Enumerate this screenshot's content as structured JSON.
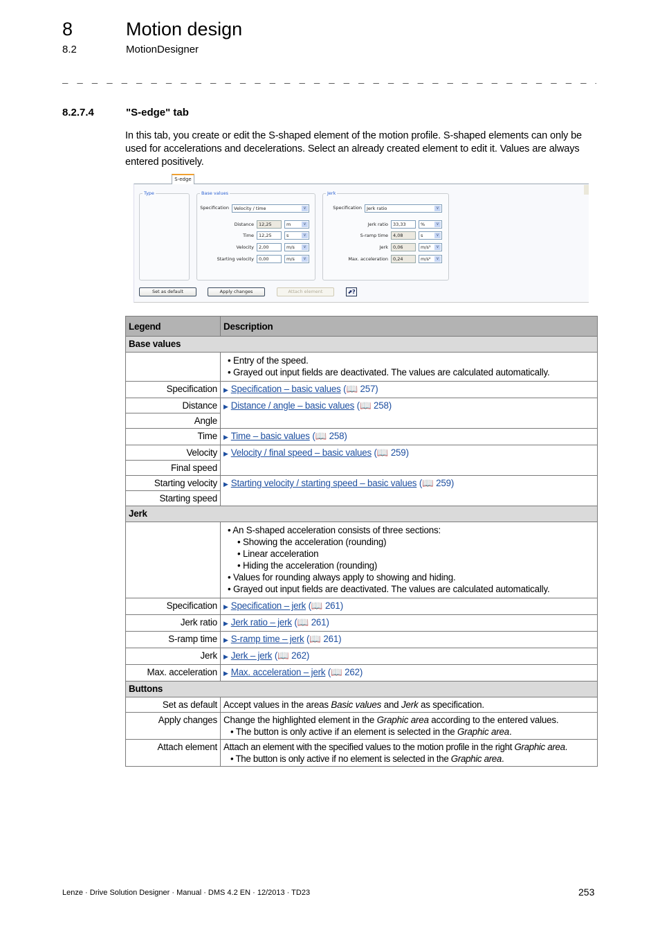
{
  "header": {
    "chapter_number": "8",
    "chapter_title": "Motion design",
    "section_number": "8.2",
    "section_title": "MotionDesigner",
    "separator": "_ _ _ _ _ _ _ _ _ _ _ _ _ _ _ _ _ _ _ _ _ _ _ _ _ _ _ _ _ _ _ _ _ _ _ _ _ _ _ _ _ _ _ _ _ _ _ _ _ _ _ _ _ _ _ _ _ _ _ _ _ _ _ _"
  },
  "subsection": {
    "number": "8.2.7.4",
    "title": "\"S-edge\" tab"
  },
  "intro": "In this tab, you create or edit the S-shaped element of the motion profile. S-shaped elements can only be used for accelerations and decelerations. Select an already created element to edit it. Values are always entered positively.",
  "screenshot": {
    "tab_label": "S-edge",
    "groups": {
      "type": "Type",
      "base": "Base values",
      "jerk": "Jerk"
    },
    "base": {
      "spec_label": "Specification",
      "spec_value": "Velocity / time",
      "fields": [
        {
          "label": "Distance",
          "value": "12,25",
          "unit": "m",
          "disabled": true
        },
        {
          "label": "Time",
          "value": "12,25",
          "unit": "s",
          "disabled": false
        },
        {
          "label": "Velocity",
          "value": "2,00",
          "unit": "m/s",
          "disabled": false
        },
        {
          "label": "Starting velocity",
          "value": "0,00",
          "unit": "m/s",
          "disabled": false
        }
      ]
    },
    "jerk": {
      "spec_label": "Specification",
      "spec_value": "Jerk ratio",
      "fields": [
        {
          "label": "Jerk ratio",
          "value": "33,33",
          "unit": "%",
          "disabled": false
        },
        {
          "label": "S-ramp time",
          "value": "4,08",
          "unit": "s",
          "disabled": true
        },
        {
          "label": "Jerk",
          "value": "0,06",
          "unit": "m/s³",
          "disabled": true
        },
        {
          "label": "Max. acceleration",
          "value": "0,24",
          "unit": "m/s²",
          "disabled": true
        }
      ]
    },
    "buttons": {
      "set_default": "Set as default",
      "apply": "Apply changes",
      "attach": "Attach element",
      "help": "?"
    },
    "dropdown_arrow": "chevron-down-icon"
  },
  "table": {
    "col_legend": "Legend",
    "col_description": "Description",
    "base_values": {
      "title": "Base values",
      "intro_bullets": [
        "Entry of the speed.",
        "Grayed out input fields are deactivated. The values are calculated automatically."
      ],
      "rows": [
        {
          "legend": "Specification",
          "link": "Specification – basic values",
          "page": "257"
        },
        {
          "legend": "Distance",
          "link": "Distance / angle – basic values",
          "page": "258"
        },
        {
          "legend": "Angle"
        },
        {
          "legend": "Time",
          "link": "Time – basic values",
          "page": "258"
        },
        {
          "legend": "Velocity",
          "link": "Velocity / final speed – basic values",
          "page": "259"
        },
        {
          "legend": "Final speed"
        },
        {
          "legend": "Starting velocity",
          "link": "Starting velocity / starting speed – basic values",
          "page": "259"
        },
        {
          "legend": "Starting speed"
        }
      ]
    },
    "jerk": {
      "title": "Jerk",
      "intro": {
        "b1": "An S-shaped acceleration consists of three sections:",
        "s1": "Showing the acceleration (rounding)",
        "s2": "Linear acceleration",
        "s3": "Hiding the acceleration (rounding)",
        "b2": "Values for rounding always apply to showing and hiding.",
        "b3": "Grayed out input fields are deactivated. The values are calculated automatically."
      },
      "rows": [
        {
          "legend": "Specification",
          "link": "Specification – jerk",
          "page": "261"
        },
        {
          "legend": "Jerk ratio",
          "link": "Jerk ratio – jerk",
          "page": "261"
        },
        {
          "legend": "S-ramp time",
          "link": "S-ramp time – jerk",
          "page": "261"
        },
        {
          "legend": "Jerk",
          "link": "Jerk – jerk",
          "page": "262"
        },
        {
          "legend": "Max. acceleration",
          "link": "Max. acceleration – jerk",
          "page": "262"
        }
      ]
    },
    "buttons": {
      "title": "Buttons",
      "set_default": {
        "legend": "Set as default",
        "t1": "Accept values in the areas ",
        "i1": "Basic values",
        "t2": " and ",
        "i2": "Jerk",
        "t3": " as specification."
      },
      "apply": {
        "legend": "Apply changes",
        "t1": "Change the highlighted element in the ",
        "i1": "Graphic area",
        "t2": " according to the entered values.",
        "n1": "The button is only active if an element is selected in the ",
        "ni": "Graphic area",
        "n2": "."
      },
      "attach": {
        "legend": "Attach element",
        "t1": "Attach an element with the specified values to the motion profile in the right ",
        "i1": "Graphic area",
        "t2": ".",
        "n1": "The button is only active if no element is selected in the ",
        "ni": "Graphic area",
        "n2": "."
      }
    },
    "book_icon": "book-icon",
    "link_marker": "triangle-right-icon"
  },
  "footer": {
    "text": "Lenze · Drive Solution Designer · Manual · DMS 4.2 EN · 12/2013 · TD23",
    "page_number": "253"
  }
}
